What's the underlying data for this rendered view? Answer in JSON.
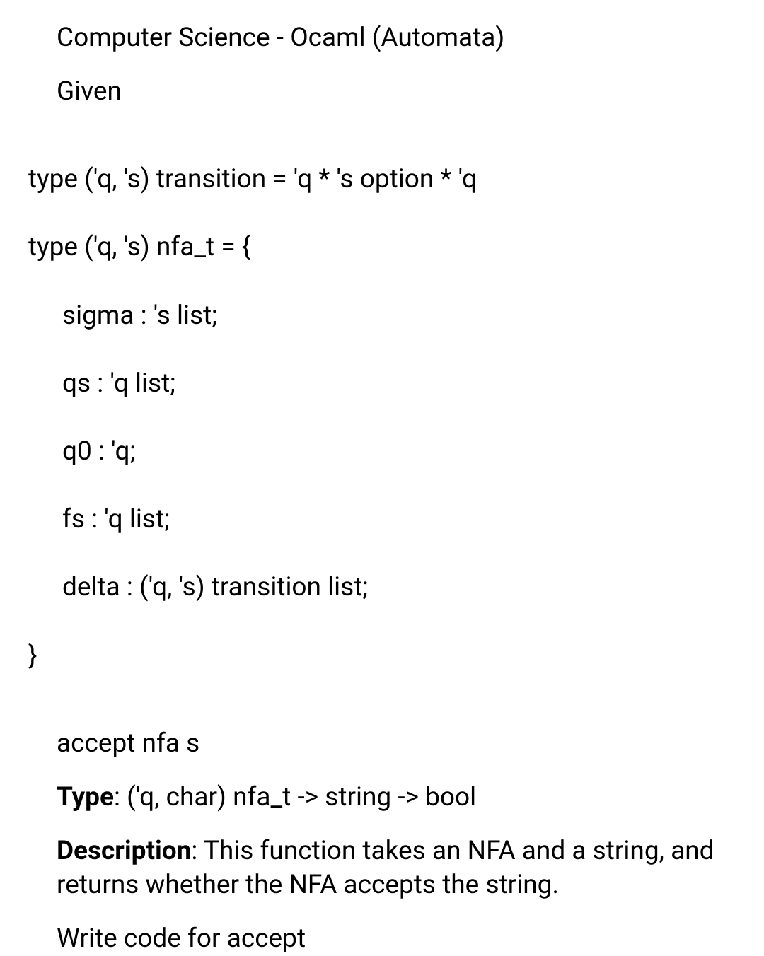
{
  "title": "Computer Science - Ocaml (Automata)",
  "given_label": "Given",
  "code": {
    "line1": "type ('q, 's) transition = 'q * 's option * 'q",
    "line2": "type ('q, 's) nfa_t = {",
    "line3": "sigma : 's list;",
    "line4": "qs : 'q list;",
    "line5": "q0 : 'q;",
    "line6": "fs : 'q list;",
    "line7": "delta : ('q, 's) transition list;",
    "line8": "}"
  },
  "accept_header": "accept nfa s",
  "type_label": "Type",
  "type_value": ": ('q, char) nfa_t -> string -> bool",
  "description_label": "Description",
  "description_value": ": This function takes an NFA and a string, and returns whether the NFA accepts the string.",
  "prompt": "Write code for accept"
}
